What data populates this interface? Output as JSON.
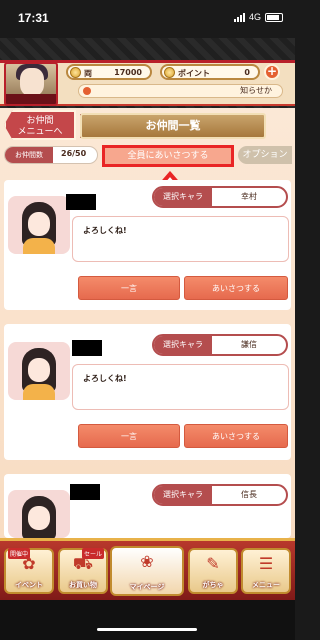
{
  "status": {
    "time": "17:31",
    "network": "4G"
  },
  "header": {
    "currency_label": "両",
    "currency_value": "17000",
    "points_label": "ポイント",
    "points_value": "0",
    "plus": "+",
    "notice": "知らせか"
  },
  "page": {
    "back_label_line1": "お仲間",
    "back_label_line2": "メニューへ",
    "title": "お仲間一覧",
    "count_label": "お仲間数",
    "count_value": "26/50",
    "greet_all": "全員にあいさつする",
    "option": "オプション"
  },
  "cards": [
    {
      "select_label": "選択キャラ",
      "character": "幸村",
      "message": "よろしくね!",
      "hitokoto": "一言",
      "greet": "あいさつする"
    },
    {
      "select_label": "選択キャラ",
      "character": "謙信",
      "message": "よろしくね!",
      "hitokoto": "一言",
      "greet": "あいさつする"
    },
    {
      "select_label": "選択キャラ",
      "character": "信長"
    }
  ],
  "nav": {
    "event": "イベント",
    "event_badge": "開催中",
    "shop": "お買い物",
    "shop_badge": "セール",
    "mypage": "マイページ",
    "gacha": "がちゃ",
    "menu": "メニュー"
  },
  "colors": {
    "accent_red": "#e92525",
    "brand": "#b44d4e"
  }
}
